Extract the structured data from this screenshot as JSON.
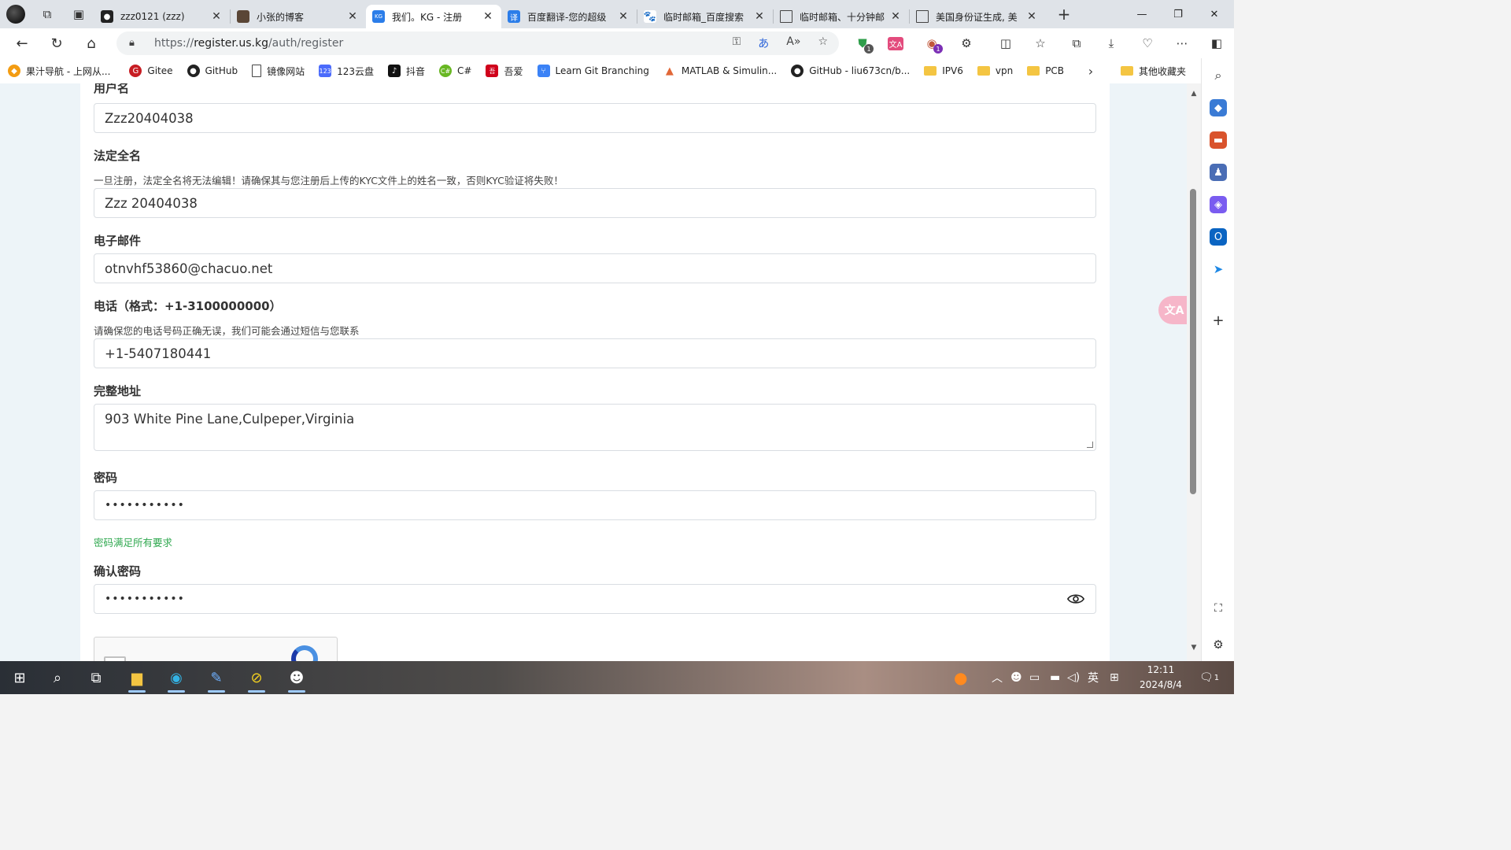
{
  "tabs": [
    {
      "title": "zzz0121 (zzz)",
      "favicon": "github-icon",
      "active": false
    },
    {
      "title": "小张的博客",
      "favicon": "avatar-icon",
      "active": false
    },
    {
      "title": "我们。KG - 注册",
      "favicon": "us-kg-icon",
      "active": true
    },
    {
      "title": "百度翻译-您的超级",
      "favicon": "baidu-translate-icon",
      "active": false
    },
    {
      "title": "临时邮箱_百度搜索",
      "favicon": "baidu-icon",
      "active": false
    },
    {
      "title": "临时邮箱、十分钟邮",
      "favicon": "page-icon",
      "active": false
    },
    {
      "title": "美国身份证生成, 美",
      "favicon": "page-icon",
      "active": false
    }
  ],
  "address_bar": {
    "scheme": "https://",
    "host": "register.us.kg",
    "path": "/auth/register"
  },
  "bookmarks": [
    {
      "label": "果汁导航 - 上网从...",
      "icon": "juice-nav-icon",
      "color": "#f39c12"
    },
    {
      "label": "Gitee",
      "icon": "gitee-icon",
      "color": "#c71d23"
    },
    {
      "label": "GitHub",
      "icon": "github-icon",
      "color": "#222222"
    },
    {
      "label": "镜像网站",
      "icon": "page-icon",
      "color": "#ffffff"
    },
    {
      "label": "123云盘",
      "icon": "123pan-icon",
      "color": "#4b6bfb"
    },
    {
      "label": "抖音",
      "icon": "douyin-icon",
      "color": "#111111"
    },
    {
      "label": "C#",
      "icon": "csharp-icon",
      "color": "#68b723"
    },
    {
      "label": "吾爱",
      "icon": "52pojie-icon",
      "color": "#d0021b"
    },
    {
      "label": "Learn Git Branching",
      "icon": "git-branch-icon",
      "color": "#3b82f6"
    },
    {
      "label": "MATLAB & Simulin...",
      "icon": "matlab-icon",
      "color": "#e16737"
    },
    {
      "label": "GitHub - liu673cn/b...",
      "icon": "github-icon",
      "color": "#222222"
    },
    {
      "label": "IPV6",
      "icon": "folder-icon",
      "color": "#f4c542"
    },
    {
      "label": "vpn",
      "icon": "folder-icon",
      "color": "#f4c542"
    },
    {
      "label": "PCB",
      "icon": "folder-icon",
      "color": "#f4c542"
    }
  ],
  "bookmarks_other": "其他收藏夹",
  "form": {
    "username": {
      "label": "用户名",
      "value": "Zzz20404038"
    },
    "legal_name": {
      "label": "法定全名",
      "help": "一旦注册，法定全名将无法编辑！请确保其与您注册后上传的KYC文件上的姓名一致，否则KYC验证将失败！",
      "value": "Zzz 20404038"
    },
    "email": {
      "label": "电子邮件",
      "value": "otnvhf53860@chacuo.net"
    },
    "phone": {
      "label": "电话（格式：+1-3100000000）",
      "help": "请确保您的电话号码正确无误，我们可能会通过短信与您联系",
      "value": "+1-5407180441"
    },
    "address": {
      "label": "完整地址",
      "value": "903 White Pine Lane,Culpeper,Virginia"
    },
    "password": {
      "label": "密码",
      "value": "•••••••••••",
      "status": "密码满足所有要求"
    },
    "confirm_password": {
      "label": "确认密码",
      "value": "•••••••••••"
    }
  },
  "taskbar": {
    "time": "12:11",
    "date": "2024/8/4",
    "ime": "英",
    "notification_count": "1"
  },
  "colors": {
    "accent": "#0078d4",
    "success": "#2fa84f",
    "page_bg": "#edf4f8"
  }
}
